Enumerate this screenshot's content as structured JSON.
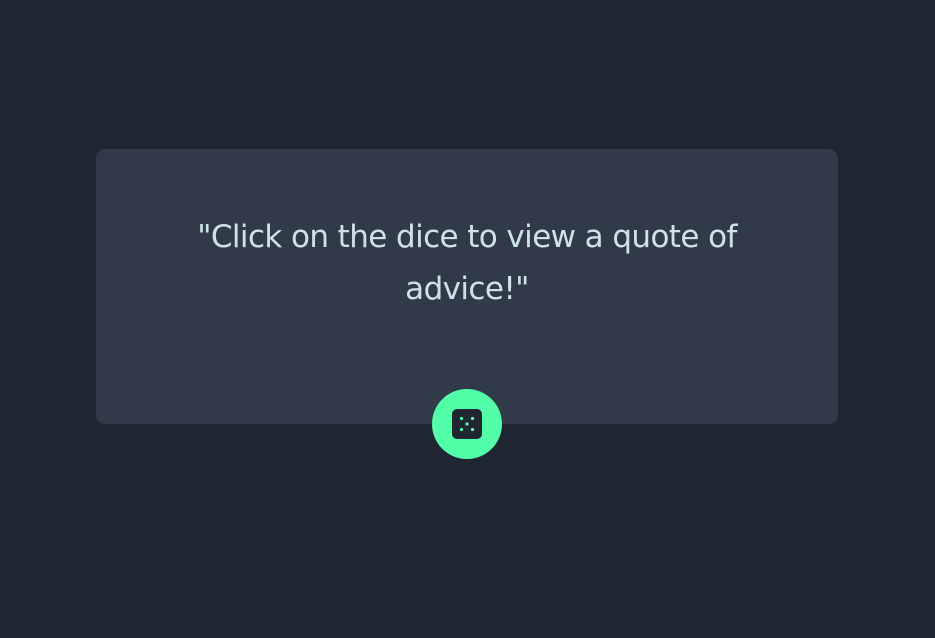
{
  "card": {
    "quote_text": "\"Click on the dice to view a quote of advice!\""
  },
  "dice_button": {
    "icon": "dice-icon"
  },
  "colors": {
    "background": "#1f2631",
    "card": "#313a49",
    "text": "#cee3e9",
    "accent": "#52ffa8"
  }
}
